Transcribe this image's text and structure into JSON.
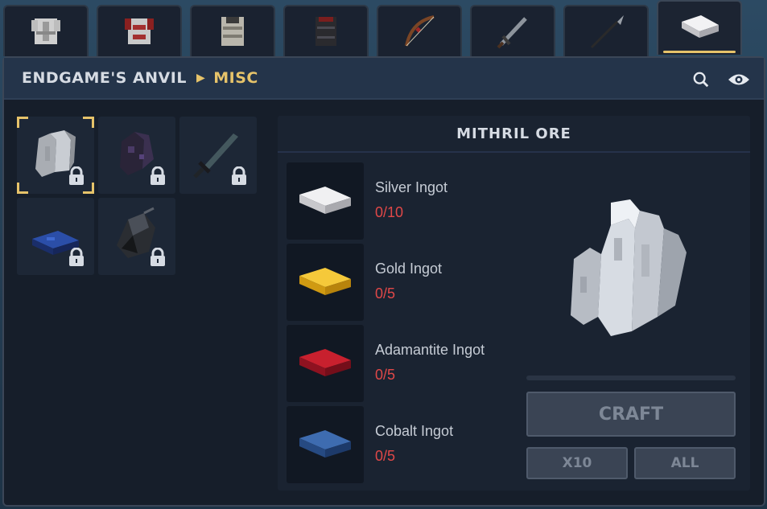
{
  "colors": {
    "accent": "#e6c36a",
    "missing": "#e04848",
    "panel": "#161e2a",
    "header": "#24344a"
  },
  "tabs": [
    {
      "icon": "chestplate-white-icon"
    },
    {
      "icon": "chestplate-red-icon"
    },
    {
      "icon": "chestplate-stone-icon"
    },
    {
      "icon": "chestplate-dark-icon"
    },
    {
      "icon": "bow-icon"
    },
    {
      "icon": "sword-icon"
    },
    {
      "icon": "spear-icon"
    },
    {
      "icon": "silver-ingot-icon",
      "active": true
    }
  ],
  "header": {
    "root": "ENDGAME'S ANVIL",
    "current": "MISC",
    "icons": [
      "search-icon",
      "eye-icon"
    ]
  },
  "recipes": [
    {
      "icon": "mithril-ore-icon",
      "locked": true,
      "selected": true
    },
    {
      "icon": "dark-crystal-icon",
      "locked": true
    },
    {
      "icon": "dark-dagger-icon",
      "locked": true
    },
    {
      "icon": "blue-ingot-icon",
      "locked": true
    },
    {
      "icon": "dark-helmet-icon",
      "locked": true
    }
  ],
  "detail": {
    "title": "MITHRIL ORE",
    "ingredients": [
      {
        "name": "Silver Ingot",
        "count": "0/10",
        "icon": "silver-ingot-icon",
        "color": "#d8d8dc"
      },
      {
        "name": "Gold Ingot",
        "count": "0/5",
        "icon": "gold-ingot-icon",
        "color": "#e8b420"
      },
      {
        "name": "Adamantite Ingot",
        "count": "0/5",
        "icon": "adamantite-ingot-icon",
        "color": "#b01828"
      },
      {
        "name": "Cobalt Ingot",
        "count": "0/5",
        "icon": "cobalt-ingot-icon",
        "color": "#2f5c9a"
      }
    ],
    "result_icon": "mithril-ore-icon",
    "progress": 0,
    "craft_label": "CRAFT",
    "x10_label": "X10",
    "all_label": "ALL"
  }
}
